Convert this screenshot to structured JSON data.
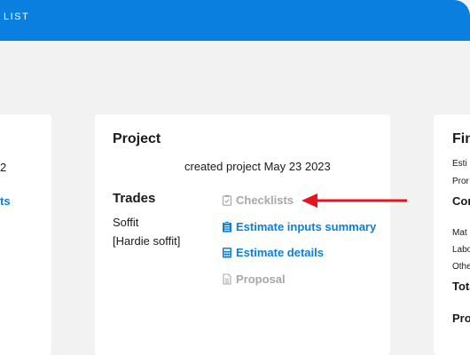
{
  "header": {
    "breadcrumb": "LIST",
    "color": "#0a7fe0"
  },
  "left_card": {
    "value": "2",
    "link": "ts"
  },
  "project_card": {
    "title": "Project",
    "created": "created project May 23 2023",
    "trades_title": "Trades",
    "trade": {
      "line1": "Soffit",
      "line2": "[Hardie soffit]"
    },
    "actions": [
      {
        "label": "Checklists",
        "icon": "clipboard-check-icon",
        "state": "disabled"
      },
      {
        "label": "Estimate inputs summary",
        "icon": "clipboard-list-icon",
        "state": "active"
      },
      {
        "label": "Estimate details",
        "icon": "calculator-icon",
        "state": "active"
      },
      {
        "label": "Proposal",
        "icon": "document-icon",
        "state": "disabled"
      }
    ]
  },
  "annotation": {
    "arrow_color": "#e8141b",
    "points_to": "Checklists"
  },
  "financial_card": {
    "title": "Fin",
    "rows": [
      "Esti",
      "Pror",
      "Cor",
      "Mat",
      "Labo",
      "Othe",
      "Tota",
      "Pro"
    ]
  }
}
